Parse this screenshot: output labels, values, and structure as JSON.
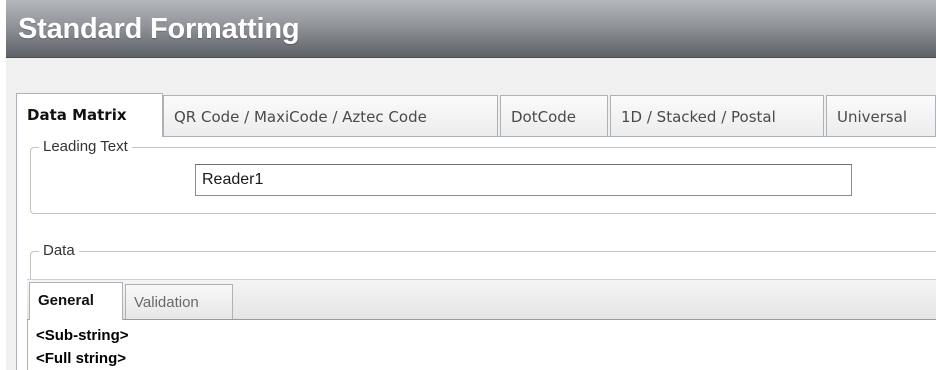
{
  "header": {
    "title": "Standard Formatting"
  },
  "tabs": [
    {
      "label": "Data Matrix",
      "active": true
    },
    {
      "label": "QR Code / MaxiCode / Aztec Code",
      "active": false
    },
    {
      "label": "DotCode",
      "active": false
    },
    {
      "label": "1D / Stacked / Postal",
      "active": false
    },
    {
      "label": "Universal",
      "active": false
    }
  ],
  "leading_text": {
    "legend": "Leading Text",
    "value": "Reader1"
  },
  "data_group": {
    "legend": "Data",
    "tabs": [
      {
        "label": "General",
        "active": true
      },
      {
        "label": "Validation",
        "active": false
      }
    ],
    "items": [
      "<Sub-string>",
      "<Full string>"
    ]
  },
  "colors": {
    "header_gradient_top": "#b4b8bd",
    "header_gradient_bottom": "#5d6168",
    "panel_background": "#f0f0f0",
    "tab_border": "#adb2b8"
  }
}
